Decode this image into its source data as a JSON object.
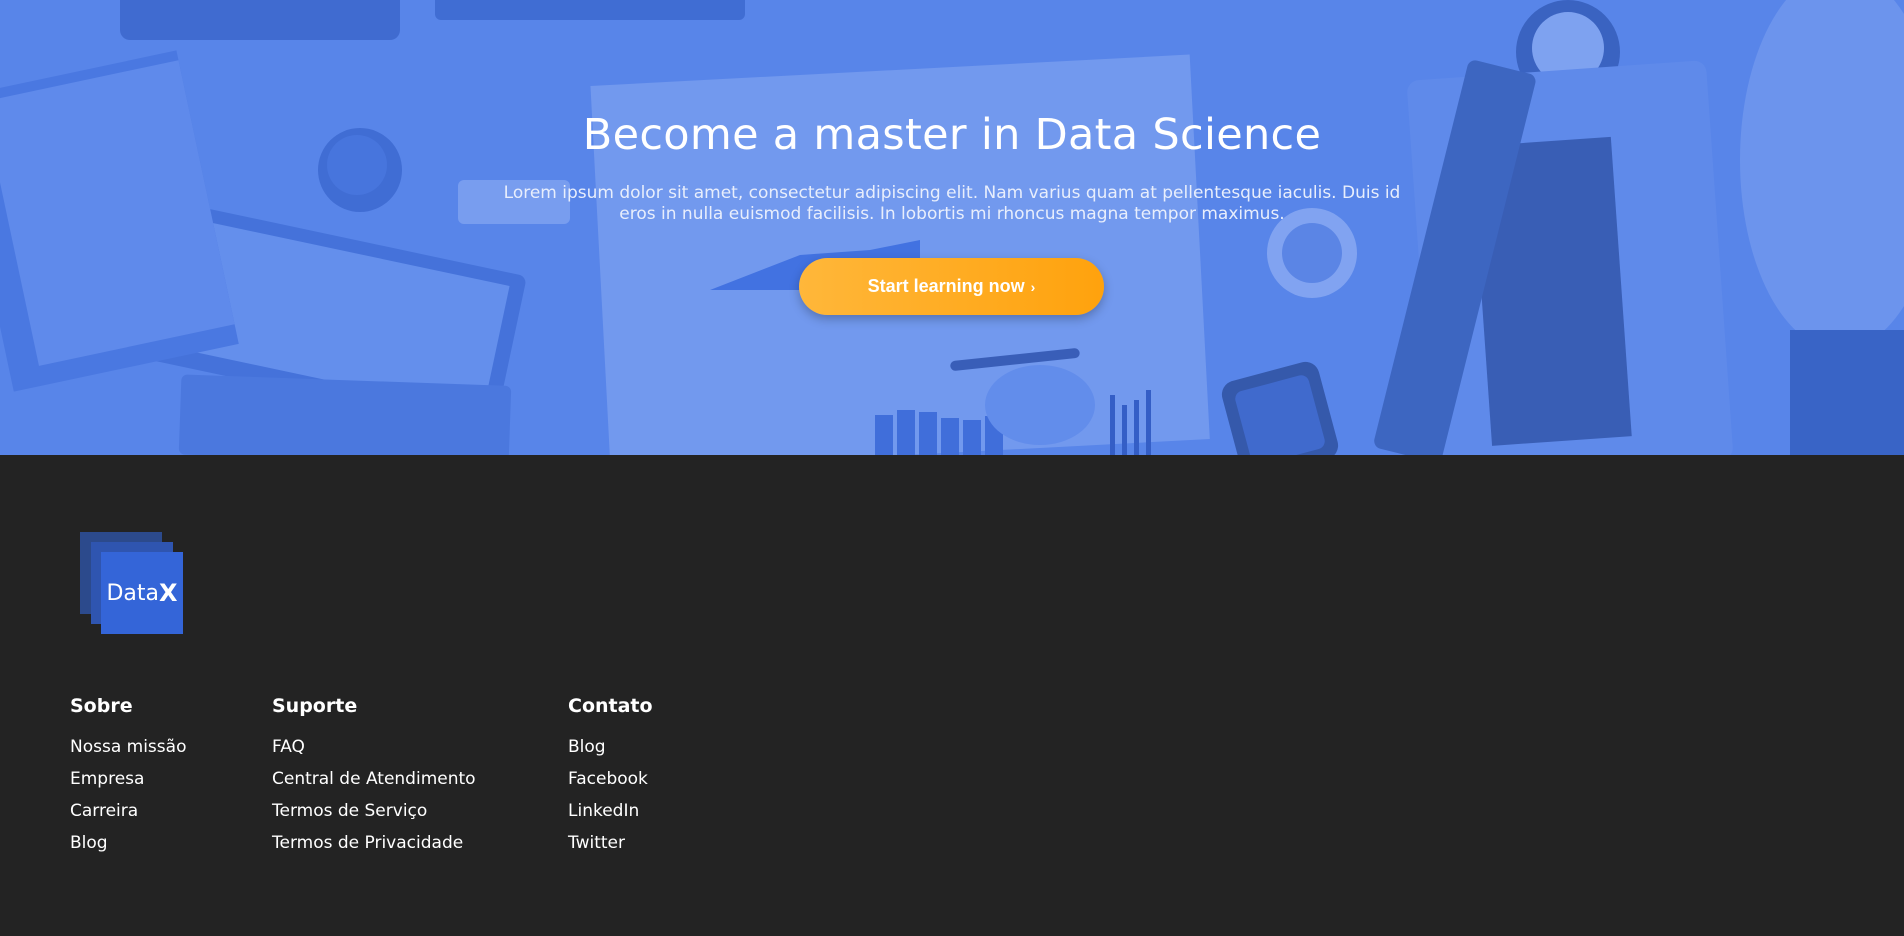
{
  "hero": {
    "title": "Become a master in Data Science",
    "subtitle": "Lorem ipsum dolor sit amet, consectetur adipiscing elit. Nam varius quam at pellentesque iaculis. Duis id eros in nulla euismod facilisis. In lobortis mi rhoncus magna tempor maximus.",
    "cta_label": "Start learning now",
    "cta_icon": "chevron-right-icon",
    "overlay_color": "#4678eb"
  },
  "footer": {
    "logo": {
      "text_light": "Data",
      "text_bold": "X"
    },
    "columns": [
      {
        "heading": "Sobre",
        "links": [
          "Nossa missão",
          "Empresa",
          "Carreira",
          "Blog"
        ]
      },
      {
        "heading": "Suporte",
        "links": [
          "FAQ",
          "Central de Atendimento",
          "Termos de Serviço",
          "Termos de Privacidade"
        ]
      },
      {
        "heading": "Contato",
        "links": [
          "Blog",
          "Facebook",
          "LinkedIn",
          "Twitter"
        ]
      }
    ]
  },
  "colors": {
    "footer_bg": "#232323",
    "cta_start": "#ffb73a",
    "cta_end": "#ffa20d",
    "logo_blue": "#3465d8"
  }
}
